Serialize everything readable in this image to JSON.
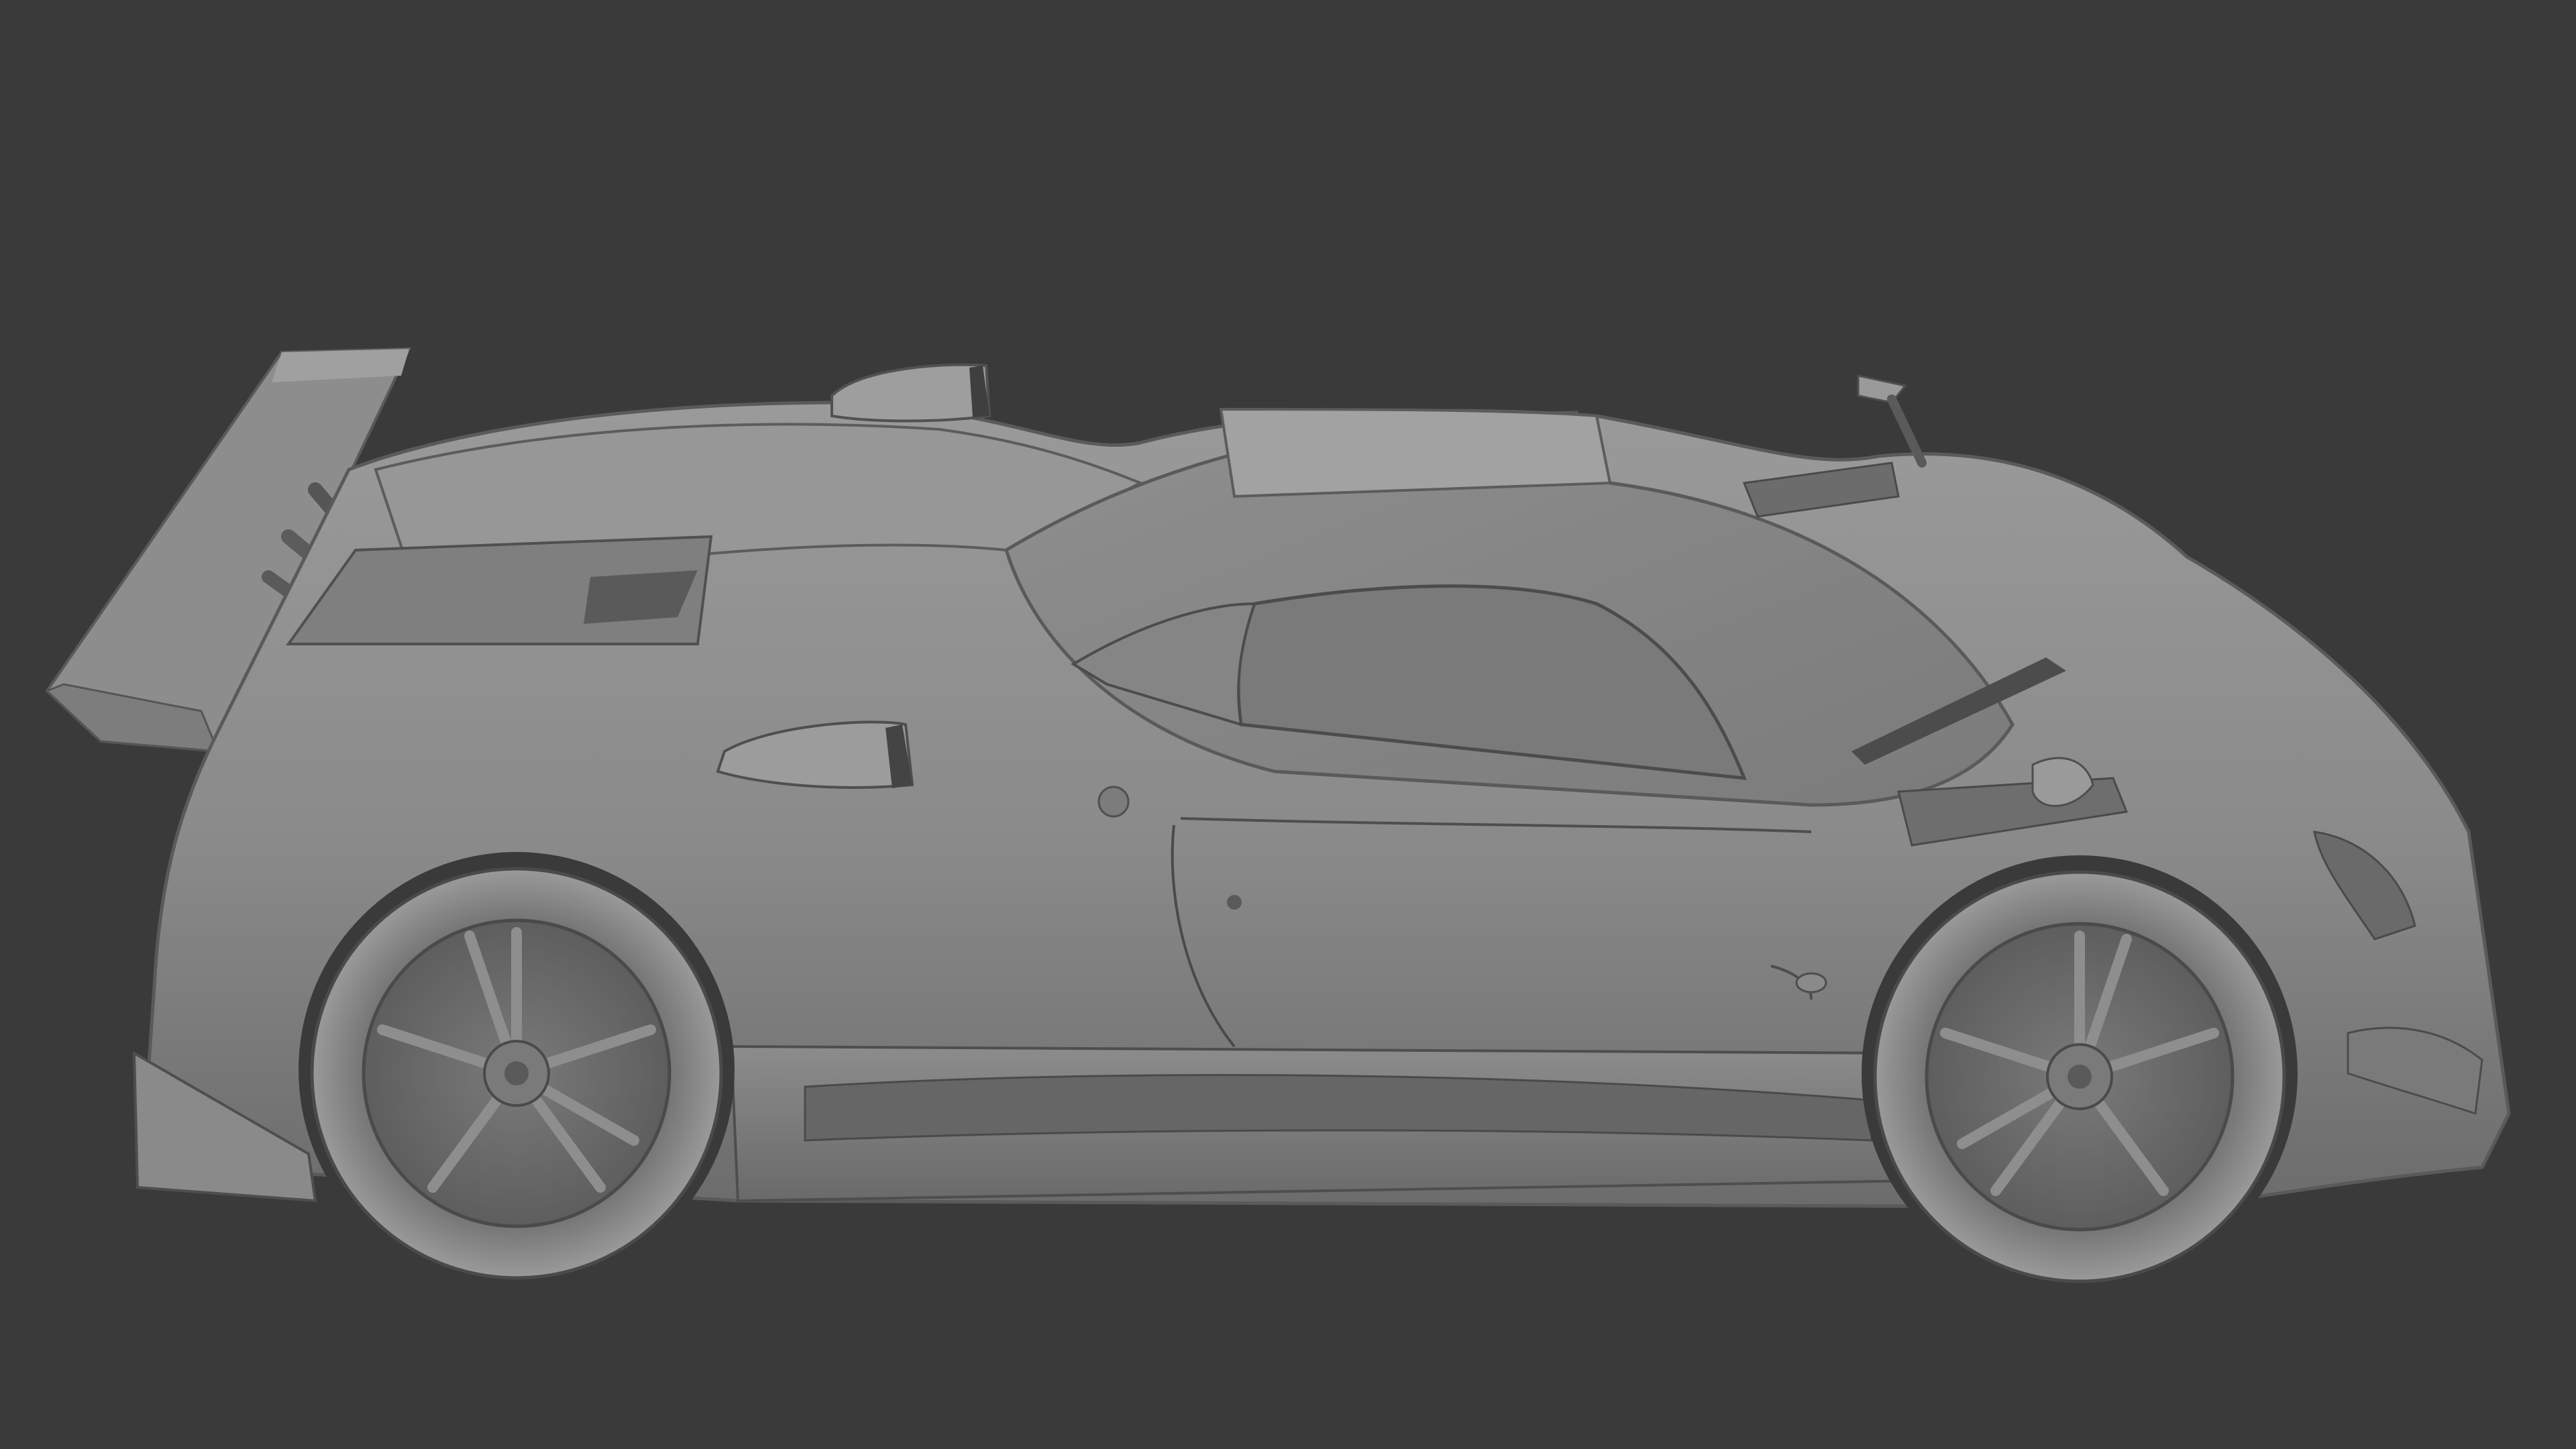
{
  "scene": {
    "subject": "car-model",
    "shading": "clay-grey",
    "background_color": "#3a3a3a",
    "clay_colors": {
      "base": "#8e8e8e",
      "light": "#a4a4a4",
      "shadow": "#5a5a5a",
      "deep": "#2f2f2f",
      "line": "#4a4a4a"
    }
  }
}
